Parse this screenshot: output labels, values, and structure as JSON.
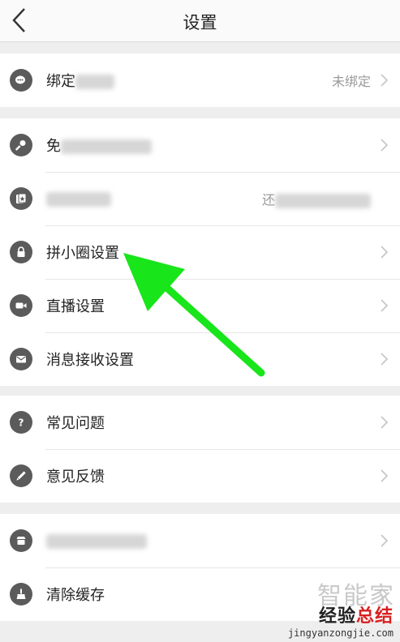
{
  "header": {
    "title": "设置"
  },
  "groups": [
    {
      "rows": [
        {
          "label": "绑定",
          "value": "未绑定"
        }
      ]
    },
    {
      "rows": [
        {
          "label": "免"
        },
        {
          "label": "",
          "value": "还"
        },
        {
          "label": "拼小圈设置"
        },
        {
          "label": "直播设置"
        },
        {
          "label": "消息接收设置"
        }
      ]
    },
    {
      "rows": [
        {
          "label": "常见问题"
        },
        {
          "label": "意见反馈"
        }
      ]
    },
    {
      "rows": [
        {
          "label": ""
        },
        {
          "label": "清除缓存"
        }
      ]
    }
  ],
  "watermark": {
    "faint": "智能家",
    "brand_part1": "经验",
    "brand_part2": "总结",
    "url": "jingyanzongjie.com"
  },
  "colors": {
    "arrow": "#18e51a",
    "icon_bg": "#5b5b5b"
  }
}
